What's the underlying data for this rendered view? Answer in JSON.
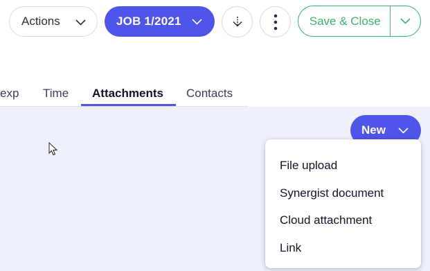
{
  "toolbar": {
    "actions_label": "Actions",
    "job_label": "JOB 1/2021",
    "save_close_label": "Save & Close"
  },
  "tabs": [
    {
      "label": "exp",
      "active": false
    },
    {
      "label": "Time",
      "active": false
    },
    {
      "label": "Attachments",
      "active": true
    },
    {
      "label": "Contacts",
      "active": false
    }
  ],
  "content": {
    "new_button_label": "New"
  },
  "new_menu": {
    "items": [
      {
        "label": "File upload"
      },
      {
        "label": "Synergist document"
      },
      {
        "label": "Cloud attachment"
      },
      {
        "label": "Link"
      }
    ]
  },
  "colors": {
    "accent": "#4f55e8",
    "success": "#3bb56d",
    "content_bg": "#eef0fb",
    "border": "#d9dbe3"
  },
  "icons": {
    "actions_chevron": "chevron-down-icon",
    "job_chevron": "chevron-down-icon",
    "download": "download-icon",
    "more": "more-vertical-icon",
    "save_chevron": "chevron-down-icon",
    "new_chevron": "chevron-down-icon",
    "cursor": "mouse-pointer-icon"
  }
}
